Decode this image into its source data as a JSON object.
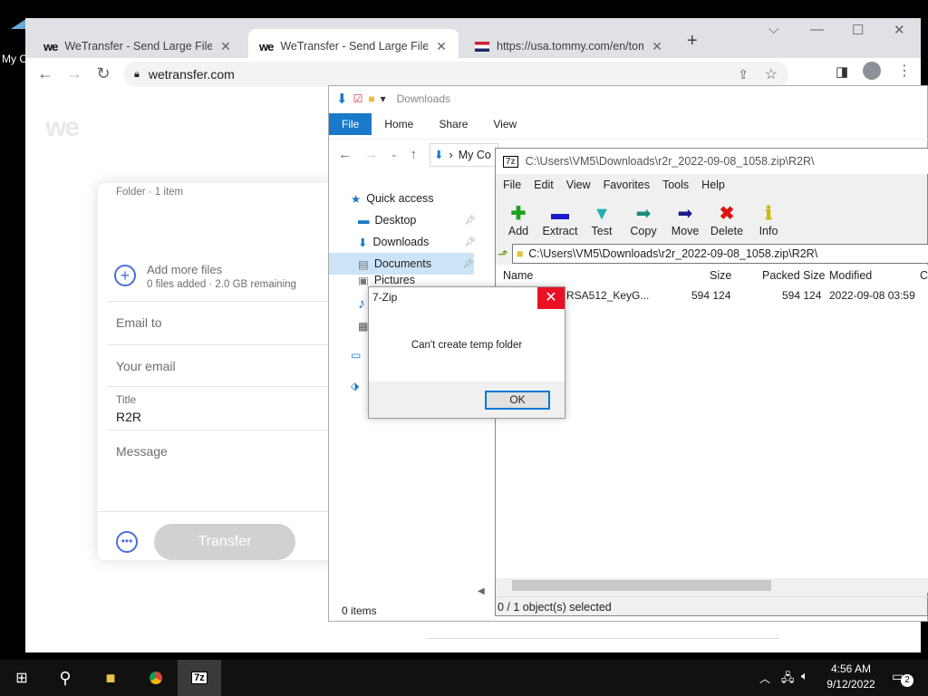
{
  "desktop": {
    "icon_label": "My C"
  },
  "chrome": {
    "tabs": [
      {
        "title": "WeTransfer - Send Large Files &",
        "icon": "we"
      },
      {
        "title": "WeTransfer - Send Large Files &",
        "icon": "we"
      },
      {
        "title": "https://usa.tommy.com/en/tom",
        "icon": "flag"
      }
    ],
    "url": "wetransfer.com"
  },
  "wetransfer": {
    "logo": "we",
    "folder_label": "Folder · 1 item",
    "add_more": "Add more files",
    "files_info": "0 files added · 2.0 GB remaining",
    "email_to": "Email to",
    "your_email": "Your email",
    "title_label": "Title",
    "title_value": "R2R",
    "message": "Message",
    "transfer": "Transfer"
  },
  "explorer": {
    "title": "Downloads",
    "ribbon": [
      "File",
      "Home",
      "Share",
      "View"
    ],
    "breadcrumb": "My Co",
    "nav_items": [
      "Quick access",
      "Desktop",
      "Downloads",
      "Documents",
      "Pictures"
    ],
    "status": "0 items"
  },
  "sevenzip": {
    "title": "C:\\Users\\VM5\\Downloads\\r2r_2022-09-08_1058.zip\\R2R\\",
    "menu": [
      "File",
      "Edit",
      "View",
      "Favorites",
      "Tools",
      "Help"
    ],
    "tools": [
      {
        "label": "Add",
        "icon": "add-icon",
        "color": "#1aa31a"
      },
      {
        "label": "Extract",
        "icon": "extract-icon",
        "color": "#1a1acc"
      },
      {
        "label": "Test",
        "icon": "test-icon",
        "color": "#20b0b0"
      },
      {
        "label": "Copy",
        "icon": "copy-icon",
        "color": "#1a8a7a"
      },
      {
        "label": "Move",
        "icon": "move-icon",
        "color": "#1a1a8a"
      },
      {
        "label": "Delete",
        "icon": "delete-icon",
        "color": "#dd1111"
      },
      {
        "label": "Info",
        "icon": "info-icon",
        "color": "#c8b800"
      }
    ],
    "address": "C:\\Users\\VM5\\Downloads\\r2r_2022-09-08_1058.zip\\R2R\\",
    "columns": [
      "Name",
      "Size",
      "Packed Size",
      "Modified",
      "Cr"
    ],
    "row": {
      "name": "RSA512_KeyG...",
      "size": "594 124",
      "packed": "594 124",
      "modified": "2022-09-08 03:59"
    },
    "status": "0 / 1 object(s) selected"
  },
  "dialog": {
    "title": "7-Zip",
    "message": "Can't create temp folder",
    "ok": "OK"
  },
  "taskbar": {
    "time": "4:56 AM",
    "date": "9/12/2022",
    "notifications": "2",
    "active_app": "7z"
  }
}
